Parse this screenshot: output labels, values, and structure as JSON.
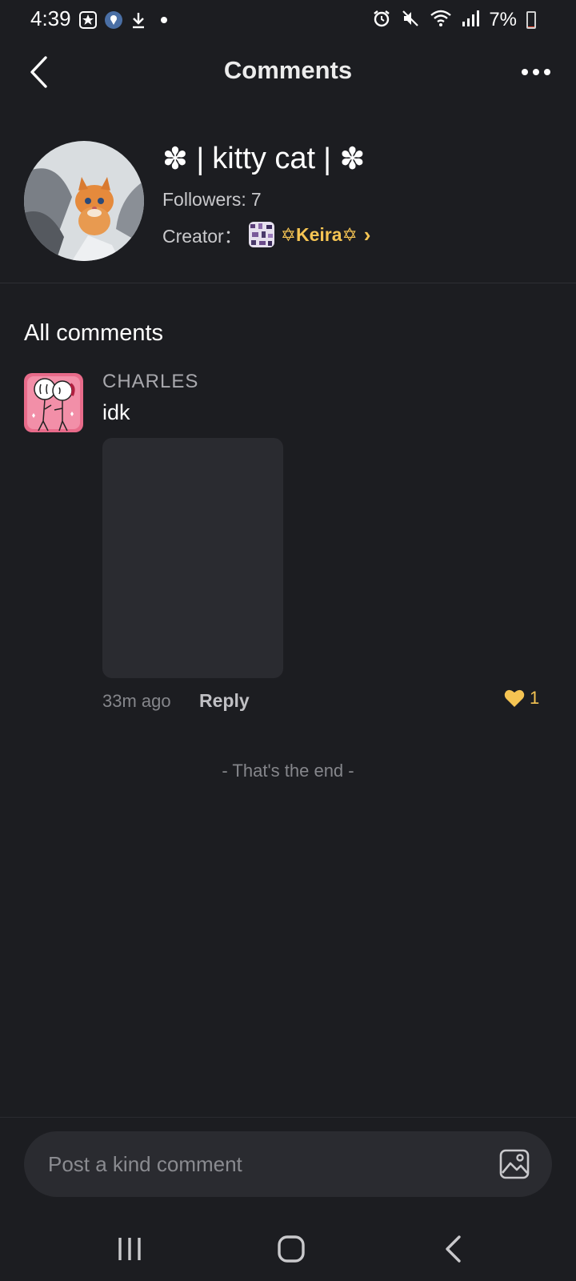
{
  "status_bar": {
    "time": "4:39",
    "battery_percent": "7%",
    "battery_level": 0.07,
    "left_icons": [
      "star-app-icon",
      "location-icon",
      "download-icon",
      "notification-dot-icon"
    ],
    "right_icons": [
      "alarm-icon",
      "mute-icon",
      "wifi-icon",
      "signal-icon",
      "battery-icon"
    ]
  },
  "header": {
    "title": "Comments",
    "back_icon": "chevron-left-icon",
    "more_icon": "more-horizontal-icon"
  },
  "topic": {
    "title_text": "kitty cat",
    "title_prefix_symbol": "✽ |",
    "title_suffix_symbol": "| ✽",
    "followers_label": "Followers:",
    "followers_count": "7",
    "creator_label": "Creator：",
    "creator_name": "✡Keira✡",
    "creator_arrow": "›"
  },
  "comments_section": {
    "title": "All comments",
    "comments": [
      {
        "username": "CHARLES",
        "text": "idk",
        "time": "33m ago",
        "reply_label": "Reply",
        "likes": "1"
      }
    ],
    "end_text": "- That's the end -"
  },
  "input": {
    "placeholder": "Post a kind comment",
    "image_icon": "image-icon"
  },
  "colors": {
    "background": "#1c1d21",
    "accent": "#f5c453",
    "surface": "#2a2b30"
  }
}
